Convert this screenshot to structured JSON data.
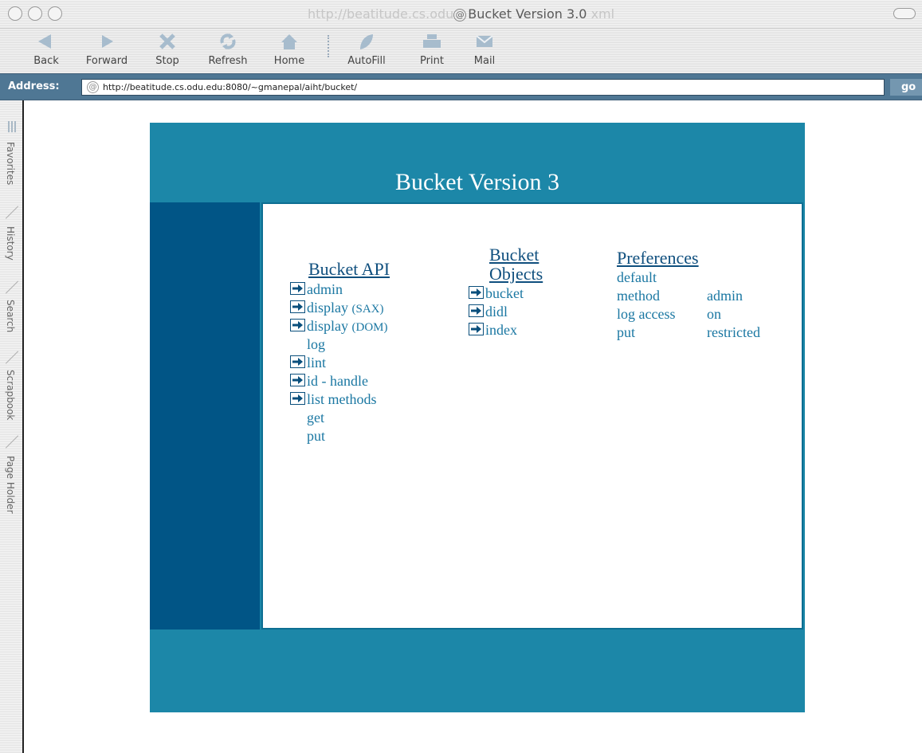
{
  "window": {
    "title_ghost_prefix": "http://beatitude.cs.odu",
    "title": "Bucket Version 3.0",
    "title_ghost_suffix": "xml"
  },
  "toolbar": {
    "buttons": [
      {
        "label": "Back",
        "icon": "back-arrow-icon"
      },
      {
        "label": "Forward",
        "icon": "forward-arrow-icon"
      },
      {
        "label": "Stop",
        "icon": "stop-x-icon"
      },
      {
        "label": "Refresh",
        "icon": "refresh-icon"
      },
      {
        "label": "Home",
        "icon": "home-icon"
      },
      {
        "label": "AutoFill",
        "icon": "autofill-icon"
      },
      {
        "label": "Print",
        "icon": "printer-icon"
      },
      {
        "label": "Mail",
        "icon": "mail-icon"
      }
    ]
  },
  "address": {
    "label": "Address:",
    "url": "http://beatitude.cs.odu.edu:8080/~gmanepal/aiht/bucket/",
    "go_label": "go"
  },
  "sidebar_tabs": [
    "Favorites",
    "History",
    "Search",
    "Scrapbook",
    "Page Holder"
  ],
  "page": {
    "title": "Bucket Version 3",
    "api": {
      "title": "Bucket API",
      "items": [
        {
          "text": "admin",
          "suffix": "",
          "arrow": true
        },
        {
          "text": "display",
          "suffix": "(SAX)",
          "arrow": true
        },
        {
          "text": "display",
          "suffix": "(DOM)",
          "arrow": true
        },
        {
          "text": "log",
          "suffix": "",
          "arrow": false
        },
        {
          "text": "lint",
          "suffix": "",
          "arrow": true
        },
        {
          "text": "id - handle",
          "suffix": "",
          "arrow": true
        },
        {
          "text": "list methods",
          "suffix": "",
          "arrow": true
        },
        {
          "text": "get",
          "suffix": "",
          "arrow": false
        },
        {
          "text": "put",
          "suffix": "",
          "arrow": false
        }
      ]
    },
    "objects": {
      "title_line1": "Bucket",
      "title_line2": "Objects",
      "items": [
        "bucket",
        "didl",
        "index"
      ]
    },
    "preferences": {
      "title": "Preferences",
      "rows": [
        {
          "key": "default",
          "value": ""
        },
        {
          "key": "method",
          "value": "admin"
        },
        {
          "key": "log access",
          "value": "on"
        },
        {
          "key": "put",
          "value": "restricted"
        }
      ]
    }
  }
}
